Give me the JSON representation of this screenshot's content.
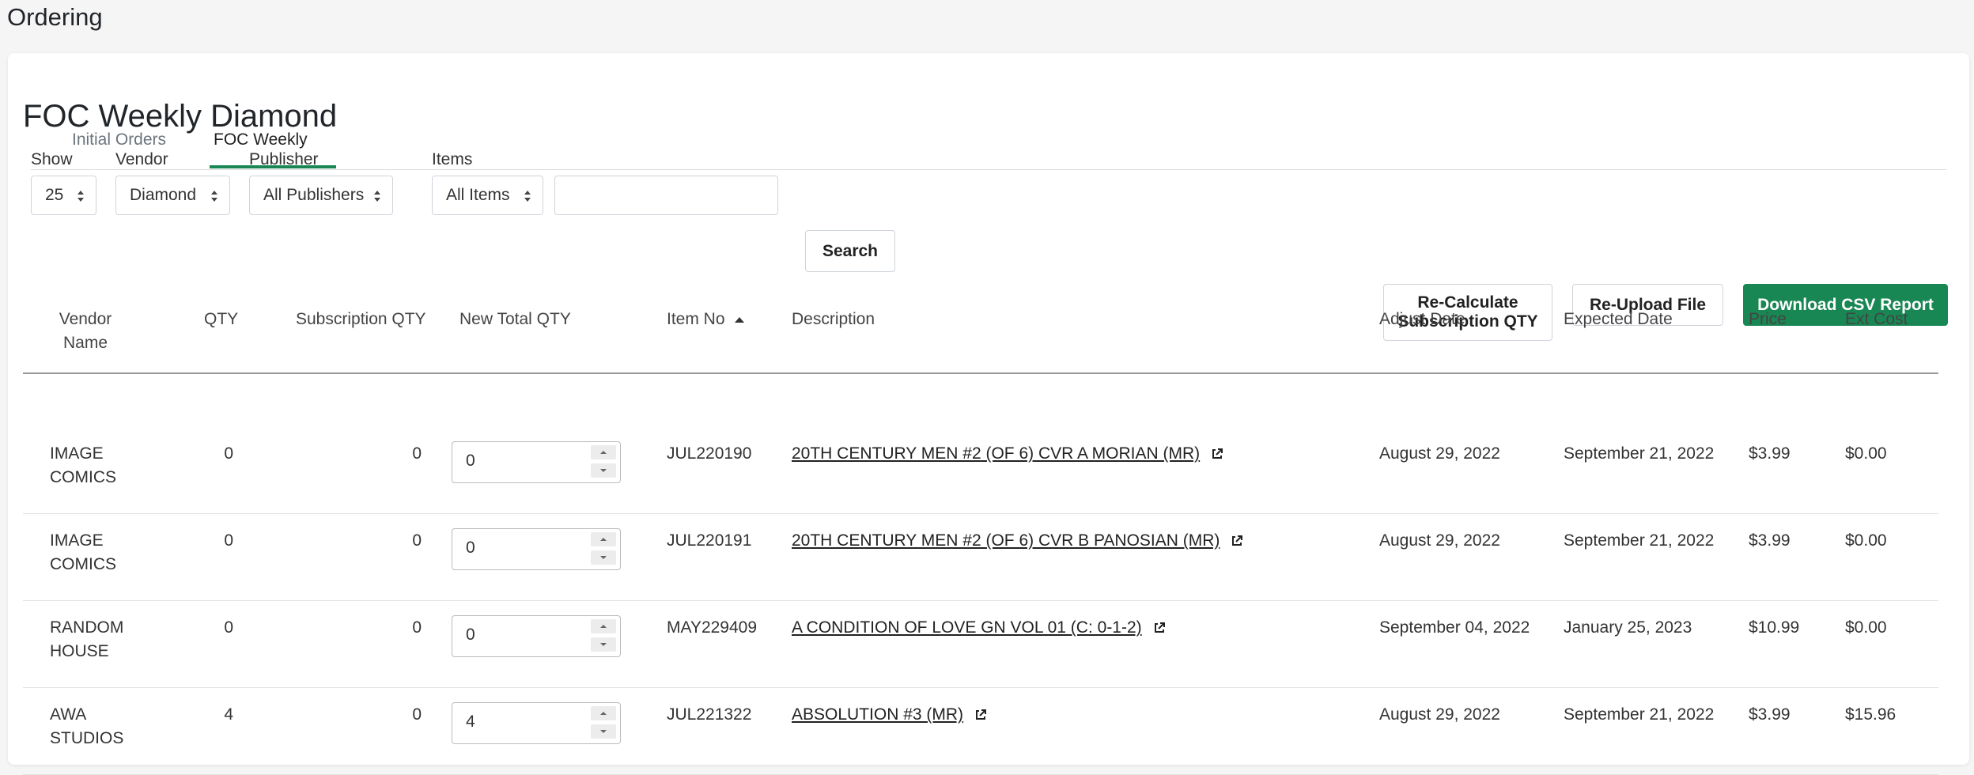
{
  "page": {
    "title": "Ordering"
  },
  "tabs": [
    {
      "label": "Initial Orders",
      "active": false
    },
    {
      "label": "FOC Weekly",
      "active": true
    }
  ],
  "section_title": "FOC Weekly Diamond",
  "filters": {
    "show": {
      "label": "Show",
      "value": "25"
    },
    "vendor": {
      "label": "Vendor",
      "value": "Diamond"
    },
    "publisher": {
      "label": "Publisher",
      "value": "All Publishers"
    },
    "items": {
      "label": "Items",
      "value": "All Items"
    },
    "search_value": "",
    "search_button": "Search"
  },
  "actions": {
    "recalc": "Re-Calculate Subscription QTY",
    "reupload": "Re-Upload File",
    "download": "Download CSV Report"
  },
  "colors": {
    "accent": "#198754"
  },
  "table": {
    "headers": {
      "vendor": "Vendor Name",
      "qty": "QTY",
      "sub_qty": "Subscription QTY",
      "new_total": "New Total QTY",
      "item_no": "Item No",
      "description": "Description",
      "adjust_date": "Adjust Date",
      "expected_date": "Expected Date",
      "price": "Price",
      "ext_cost": "Ext Cost"
    },
    "sort": {
      "column": "Item No",
      "direction": "ascending"
    },
    "rows": [
      {
        "vendor": "IMAGE COMICS",
        "qty": "0",
        "sub_qty": "0",
        "new_total": "0",
        "item_no": "JUL220190",
        "description": "20TH CENTURY MEN #2 (OF 6) CVR A MORIAN (MR)",
        "adjust_date": "August 29, 2022",
        "expected_date": "September 21, 2022",
        "price": "$3.99",
        "ext_cost": "$0.00"
      },
      {
        "vendor": "IMAGE COMICS",
        "qty": "0",
        "sub_qty": "0",
        "new_total": "0",
        "item_no": "JUL220191",
        "description": "20TH CENTURY MEN #2 (OF 6) CVR B PANOSIAN (MR)",
        "adjust_date": "August 29, 2022",
        "expected_date": "September 21, 2022",
        "price": "$3.99",
        "ext_cost": "$0.00"
      },
      {
        "vendor": "RANDOM HOUSE",
        "qty": "0",
        "sub_qty": "0",
        "new_total": "0",
        "item_no": "MAY229409",
        "description": "A CONDITION OF LOVE GN VOL 01 (C: 0-1-2)",
        "adjust_date": "September 04, 2022",
        "expected_date": "January 25, 2023",
        "price": "$10.99",
        "ext_cost": "$0.00"
      },
      {
        "vendor": "AWA STUDIOS",
        "qty": "4",
        "sub_qty": "0",
        "new_total": "4",
        "item_no": "JUL221322",
        "description": "ABSOLUTION #3 (MR)",
        "adjust_date": "August 29, 2022",
        "expected_date": "September 21, 2022",
        "price": "$3.99",
        "ext_cost": "$15.96"
      }
    ]
  }
}
